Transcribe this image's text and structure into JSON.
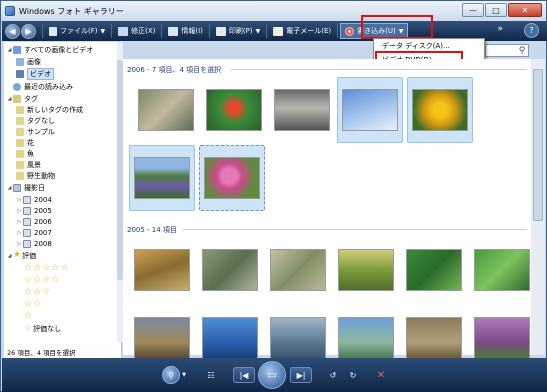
{
  "window": {
    "title": "Windows フォト ギャラリー",
    "minimize_icon": "minimize-icon",
    "maximize_icon": "maximize-icon",
    "close_icon": "close-icon"
  },
  "toolbar": {
    "file": "ファイル(F)",
    "fix": "修正(X)",
    "info": "情報(I)",
    "print": "印刷(P)",
    "email": "電子メール(E)",
    "burn": "書き込み(U)",
    "more": "»",
    "help": "?"
  },
  "burn_menu": {
    "items": [
      "データ ディスク(A)...",
      "ビデオ DVD(D)..."
    ]
  },
  "sidebar": {
    "items": [
      {
        "label": "すべての画像とビデオ",
        "indent": 0,
        "tri": "◢"
      },
      {
        "label": "画像",
        "indent": 1,
        "tri": ""
      },
      {
        "label": "ビデオ",
        "indent": 1,
        "tri": "",
        "selected": true
      },
      {
        "label": "最近の読み込み",
        "indent": 0,
        "tri": ""
      },
      {
        "label": "タグ",
        "indent": 0,
        "tri": "◢"
      },
      {
        "label": "新しいタグの作成",
        "indent": 1,
        "tri": ""
      },
      {
        "label": "タグなし",
        "indent": 1,
        "tri": ""
      },
      {
        "label": "サンプル",
        "indent": 1,
        "tri": ""
      },
      {
        "label": "花",
        "indent": 1,
        "tri": ""
      },
      {
        "label": "魚",
        "indent": 1,
        "tri": ""
      },
      {
        "label": "風景",
        "indent": 1,
        "tri": ""
      },
      {
        "label": "野生動物",
        "indent": 1,
        "tri": ""
      },
      {
        "label": "撮影日",
        "indent": 0,
        "tri": "◢"
      },
      {
        "label": "2004",
        "indent": 1,
        "tri": "▷"
      },
      {
        "label": "2005",
        "indent": 1,
        "tri": "▷"
      },
      {
        "label": "2006",
        "indent": 1,
        "tri": "▷"
      },
      {
        "label": "2007",
        "indent": 1,
        "tri": "▷"
      },
      {
        "label": "2008",
        "indent": 1,
        "tri": "▷"
      },
      {
        "label": "評価",
        "indent": 0,
        "tri": "◢"
      }
    ],
    "rating_rows": [
      5,
      4,
      3,
      2,
      1
    ],
    "unrated": "評価なし",
    "status": "26 項目、4 項目を選択"
  },
  "gallery": {
    "groups": [
      {
        "label": "2006 - 7 項目、4 項目を選択"
      },
      {
        "label": "2005 - 14 項目"
      }
    ]
  },
  "bottombar": {
    "zoom_icon": "zoom-icon",
    "table_icon": "table-view-icon",
    "prev_icon": "previous-icon",
    "slideshow_icon": "slideshow-icon",
    "next_icon": "next-icon",
    "rotate_left_icon": "rotate-left-icon",
    "rotate_right_icon": "rotate-right-icon",
    "delete_icon": "delete-icon"
  }
}
